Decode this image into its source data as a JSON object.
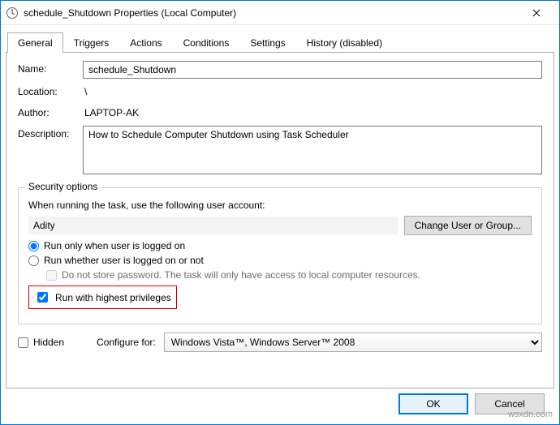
{
  "window": {
    "title": "schedule_Shutdown Properties (Local Computer)"
  },
  "tabs": [
    {
      "label": "General",
      "active": true
    },
    {
      "label": "Triggers",
      "active": false
    },
    {
      "label": "Actions",
      "active": false
    },
    {
      "label": "Conditions",
      "active": false
    },
    {
      "label": "Settings",
      "active": false
    },
    {
      "label": "History (disabled)",
      "active": false
    }
  ],
  "general": {
    "name_label": "Name:",
    "name_value": "schedule_Shutdown",
    "location_label": "Location:",
    "location_value": "\\",
    "author_label": "Author:",
    "author_value": "LAPTOP-AK",
    "description_label": "Description:",
    "description_value": "How to Schedule Computer Shutdown using Task Scheduler"
  },
  "security": {
    "legend": "Security options",
    "intro": "When running the task, use the following user account:",
    "user": "Adity",
    "change_user_btn": "Change User or Group...",
    "radio_loggedon": "Run only when user is logged on",
    "radio_whether": "Run whether user is logged on or not",
    "donot_store": "Do not store password.  The task will only have access to local computer resources.",
    "highest_priv": "Run with highest privileges"
  },
  "bottom": {
    "hidden_label": "Hidden",
    "configure_label": "Configure for:",
    "configure_value": "Windows Vista™, Windows Server™ 2008"
  },
  "footer": {
    "ok": "OK",
    "cancel": "Cancel"
  },
  "watermark": "wsxdn.com"
}
